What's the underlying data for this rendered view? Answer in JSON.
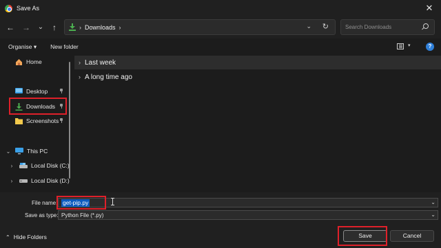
{
  "window": {
    "title": "Save As"
  },
  "nav": {
    "back_icon": "←",
    "forward_icon": "→",
    "recent_icon": "⌄",
    "up_icon": "↑",
    "breadcrumb": [
      "Downloads"
    ],
    "crumb_sep": "›",
    "addr_dropdown_icon": "⌄",
    "refresh_icon": "↻"
  },
  "search": {
    "placeholder": "Search Downloads"
  },
  "toolbar": {
    "organise_label": "Organise ▾",
    "new_folder_label": "New folder",
    "view_chevron": "▾",
    "help_label": "?"
  },
  "sidebar": {
    "home": "Home",
    "quick_access": [
      {
        "label": "Desktop"
      },
      {
        "label": "Downloads"
      },
      {
        "label": "Screenshots"
      }
    ],
    "this_pc": "This PC",
    "drives": [
      {
        "label": "Local Disk (C:)"
      },
      {
        "label": "Local Disk (D:)"
      }
    ],
    "tree_chevron_expanded": "⌄",
    "tree_chevron_collapsed": "›"
  },
  "main": {
    "groups": [
      {
        "label": "Last week",
        "selected": true
      },
      {
        "label": "A long time ago",
        "selected": false
      }
    ],
    "group_chevron": "›"
  },
  "form": {
    "file_name_label": "File name:",
    "file_name_value": "get-pip.py",
    "save_type_label": "Save as type:",
    "save_type_value": "Python File (*.py)",
    "dropdown_icon": "⌄"
  },
  "footer": {
    "hide_folders_label": "Hide Folders",
    "hide_folders_icon": "⌃",
    "save_label": "Save",
    "cancel_label": "Cancel"
  },
  "colors": {
    "highlight": "#e0202a",
    "selection": "#0b5bbf",
    "accent_green": "#4caf50",
    "folder_yellow": "#f2c94c"
  }
}
